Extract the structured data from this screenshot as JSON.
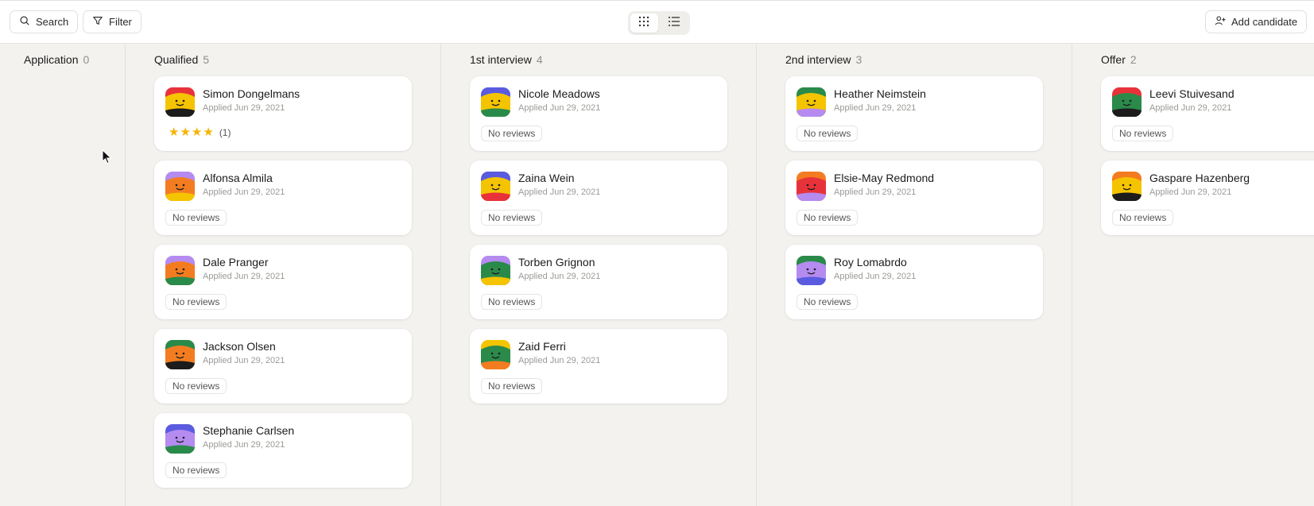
{
  "toolbar": {
    "search_label": "Search",
    "filter_label": "Filter",
    "add_label": "Add candidate",
    "icons": {
      "search": "search-icon",
      "filter": "filter-icon",
      "add": "add-user-icon",
      "grid": "grid-view-icon",
      "list": "list-view-icon"
    }
  },
  "columns": [
    {
      "title": "Application",
      "count": "0",
      "cards": []
    },
    {
      "title": "Qualified",
      "count": "5",
      "cards": [
        {
          "name": "Simon Dongelmans",
          "applied": "Applied Jun 29, 2021",
          "review": "",
          "stars": 4,
          "star_count": "(1)",
          "colors": [
            "#f5c400",
            "#e8323a",
            "#1c1c1c"
          ]
        },
        {
          "name": "Alfonsa Almila",
          "applied": "Applied Jun 29, 2021",
          "review": "No reviews",
          "colors": [
            "#f47c20",
            "#b58bf0",
            "#f5c400"
          ]
        },
        {
          "name": "Dale Pranger",
          "applied": "Applied Jun 29, 2021",
          "review": "No reviews",
          "colors": [
            "#f47c20",
            "#b58bf0",
            "#2a8a4a"
          ]
        },
        {
          "name": "Jackson Olsen",
          "applied": "Applied Jun 29, 2021",
          "review": "No reviews",
          "colors": [
            "#f47c20",
            "#2a8a4a",
            "#1c1c1c"
          ]
        },
        {
          "name": "Stephanie Carlsen",
          "applied": "Applied Jun 29, 2021",
          "review": "No reviews",
          "colors": [
            "#b58bf0",
            "#5b5be0",
            "#2a8a4a"
          ]
        }
      ]
    },
    {
      "title": "1st interview",
      "count": "4",
      "cards": [
        {
          "name": "Nicole Meadows",
          "applied": "Applied Jun 29, 2021",
          "review": "No reviews",
          "colors": [
            "#f5c400",
            "#5b5be0",
            "#2a8a4a"
          ]
        },
        {
          "name": "Zaina Wein",
          "applied": "Applied Jun 29, 2021",
          "review": "No reviews",
          "colors": [
            "#f5c400",
            "#5b5be0",
            "#e8323a"
          ]
        },
        {
          "name": "Torben Grignon",
          "applied": "Applied Jun 29, 2021",
          "review": "No reviews",
          "colors": [
            "#2a8a4a",
            "#b58bf0",
            "#f5c400"
          ]
        },
        {
          "name": "Zaid Ferri",
          "applied": "Applied Jun 29, 2021",
          "review": "No reviews",
          "colors": [
            "#2a8a4a",
            "#f5c400",
            "#f47c20"
          ]
        }
      ]
    },
    {
      "title": "2nd interview",
      "count": "3",
      "cards": [
        {
          "name": "Heather Neimstein",
          "applied": "Applied Jun 29, 2021",
          "review": "No reviews",
          "colors": [
            "#f5c400",
            "#2a8a4a",
            "#b58bf0"
          ]
        },
        {
          "name": "Elsie-May Redmond",
          "applied": "Applied Jun 29, 2021",
          "review": "No reviews",
          "colors": [
            "#e8323a",
            "#f47c20",
            "#b58bf0"
          ]
        },
        {
          "name": "Roy Lomabrdo",
          "applied": "Applied Jun 29, 2021",
          "review": "No reviews",
          "colors": [
            "#b58bf0",
            "#2a8a4a",
            "#5b5be0"
          ]
        }
      ]
    },
    {
      "title": "Offer",
      "count": "2",
      "cards": [
        {
          "name": "Leevi Stuivesand",
          "applied": "Applied Jun 29, 2021",
          "review": "No reviews",
          "colors": [
            "#2a8a4a",
            "#e8323a",
            "#1c1c1c"
          ]
        },
        {
          "name": "Gaspare Hazenberg",
          "applied": "Applied Jun 29, 2021",
          "review": "No reviews",
          "colors": [
            "#f5c400",
            "#f47c20",
            "#1c1c1c"
          ]
        }
      ]
    }
  ]
}
